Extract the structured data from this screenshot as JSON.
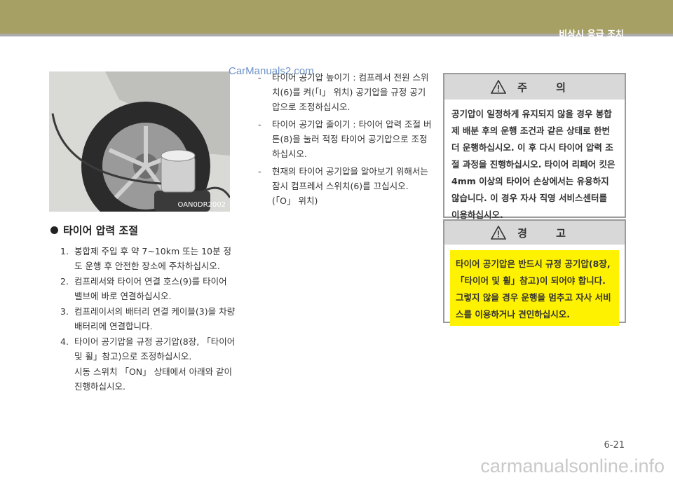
{
  "header": {
    "section_title": "비상시 응급 조치"
  },
  "figure": {
    "code": "OAN0DR2002",
    "watermark": "CarManuals2.com"
  },
  "section": {
    "heading": "타이어 압력 조절"
  },
  "steps": [
    {
      "num": "1.",
      "text": "봉합제 주입 후 약 7~10km 또는 10분 정도 운행 후 안전한 장소에 주차하십시오."
    },
    {
      "num": "2.",
      "text": "컴프레서와 타이어 연결 호스(9)를 타이어 밸브에 바로 연결하십시오."
    },
    {
      "num": "3.",
      "text": "컴프레이서의 배터리 연결 케이블(3)을 차량 배터리에 연결합니다."
    },
    {
      "num": "4.",
      "text": "타이어 공기압을 규정 공기압(8장, 「타이어 및 휠」참고)으로 조정하십시오."
    }
  ],
  "step_note": "시동 스위치 「ON」 상태에서 아래와 같이 진행하십시오.",
  "dash_items": [
    {
      "mark": "-",
      "text": "타이어 공기압 높이기 : 컴프레서 전원 스위치(6)를 켜(「I」 위치) 공기압을 규정 공기압으로 조정하십시오."
    },
    {
      "mark": "-",
      "text": "타이어 공기압 줄이기 : 타이어 압력 조절 버튼(8)을 눌러 적정 타이어 공기압으로 조정하십시오."
    },
    {
      "mark": "-",
      "text": "현재의 타이어 공기압을 알아보기 위해서는 잠시 컴프레서 스위치(6)를 끄십시오. (「O」 위치)"
    }
  ],
  "caution": {
    "title": "주 의",
    "text": "공기압이 일정하게 유지되지 않을 경우 봉합제 배분 후의 운행 조건과 같은 상태로 한번 더 운행하십시오. 이 후 다시 타이어 압력 조절 과정을 진행하십시오. 타이어 리페어 킷은 4mm 이상의 타이어 손상에서는 유용하지 않습니다. 이 경우 자사 직영 서비스센터를 이용하십시오."
  },
  "warning": {
    "title": "경 고",
    "text": "타이어 공기압은 반드시 규정 공기압(8장, 「타이어 및 휠」참고)이 되어야 합니다. 그렇지 않을 경우 운행을 멈추고 자사 서비스를 이용하거나 견인하십시오."
  },
  "page_number": "6-21",
  "footer_watermark": "carmanualsonline.info"
}
